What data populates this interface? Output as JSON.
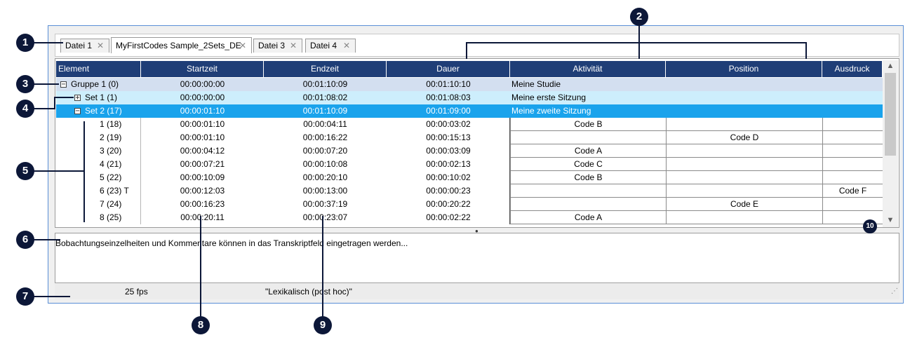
{
  "tabs": [
    {
      "label": "Datei 1",
      "close": "✕"
    },
    {
      "label": "MyFirstCodes Sample_2Sets_DE",
      "close": "✕"
    },
    {
      "label": "Datei 3",
      "close": "✕"
    },
    {
      "label": "Datei 4",
      "close": "✕"
    }
  ],
  "columns": [
    "Element",
    "Startzeit",
    "Endzeit",
    "Dauer",
    "Aktivität",
    "Position",
    "Ausdruck"
  ],
  "rows": [
    {
      "element": "Gruppe 1 (0)",
      "expander": "−",
      "start": "00:00:00:00",
      "end": "00:01:10:09",
      "duration": "00:01:10:10",
      "activity": "Meine Studie",
      "position": "",
      "expression": ""
    },
    {
      "element": "Set 1 (1)",
      "expander": "+",
      "start": "00:00:00:00",
      "end": "00:01:08:02",
      "duration": "00:01:08:03",
      "activity": "Meine erste Sitzung",
      "position": "",
      "expression": ""
    },
    {
      "element": "Set 2 (17)",
      "expander": "−",
      "start": "00:00:01:10",
      "end": "00:01:10:09",
      "duration": "00:01:09:00",
      "activity": "Meine zweite Sitzung",
      "position": "",
      "expression": ""
    },
    {
      "element": "1 (18)",
      "start": "00:00:01:10",
      "end": "00:00:04:11",
      "duration": "00:00:03:02",
      "activity": "Code B",
      "position": "",
      "expression": ""
    },
    {
      "element": "2 (19)",
      "start": "00:00:01:10",
      "end": "00:00:16:22",
      "duration": "00:00:15:13",
      "activity": "",
      "position": "Code D",
      "expression": ""
    },
    {
      "element": "3 (20)",
      "start": "00:00:04:12",
      "end": "00:00:07:20",
      "duration": "00:00:03:09",
      "activity": "Code A",
      "position": "",
      "expression": ""
    },
    {
      "element": "4 (21)",
      "start": "00:00:07:21",
      "end": "00:00:10:08",
      "duration": "00:00:02:13",
      "activity": "Code C",
      "position": "",
      "expression": ""
    },
    {
      "element": "5 (22)",
      "start": "00:00:10:09",
      "end": "00:00:20:10",
      "duration": "00:00:10:02",
      "activity": "Code B",
      "position": "",
      "expression": ""
    },
    {
      "element": "6 (23) T",
      "start": "00:00:12:03",
      "end": "00:00:13:00",
      "duration": "00:00:00:23",
      "activity": "",
      "position": "",
      "expression": "Code F"
    },
    {
      "element": "7 (24)",
      "start": "00:00:16:23",
      "end": "00:00:37:19",
      "duration": "00:00:20:22",
      "activity": "",
      "position": "Code E",
      "expression": ""
    },
    {
      "element": "8 (25)",
      "start": "00:00:20:11",
      "end": "00:00:23:07",
      "duration": "00:00:02:22",
      "activity": "Code A",
      "position": "",
      "expression": ""
    }
  ],
  "notes_text": "Bobachtungseinzelheiten und Kommentare können in das Transkriptfeld eingetragen werden...",
  "status": {
    "fps": "25 fps",
    "mode": "\"Lexikalisch (post hoc)\""
  },
  "scroll": {
    "up": "▲",
    "down": "▼",
    "grip": "⋰"
  },
  "callouts": [
    "1",
    "2",
    "3",
    "4",
    "5",
    "6",
    "7",
    "8",
    "9",
    "10"
  ],
  "colors": {
    "header_bg": "#1f3e77",
    "group_row": "#d3dff0",
    "set_row": "#cdeefc",
    "selected_row": "#1aa3ec",
    "callout": "#0c1738"
  }
}
